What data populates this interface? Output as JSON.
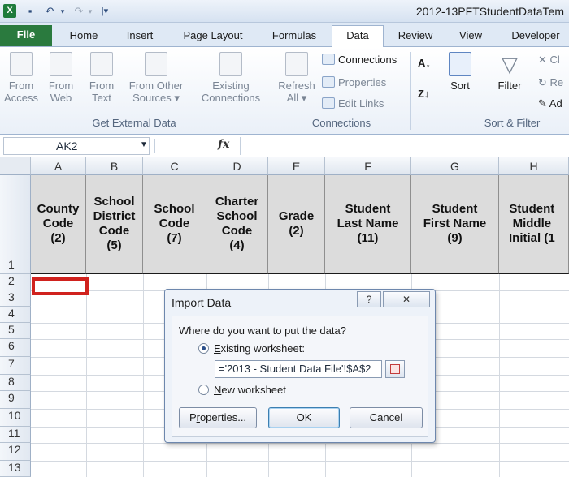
{
  "window": {
    "title": "2012-13PFTStudentDataTem"
  },
  "ribbon_tabs": [
    "File",
    "Home",
    "Insert",
    "Page Layout",
    "Formulas",
    "Data",
    "Review",
    "View",
    "Developer"
  ],
  "active_tab": "Data",
  "ribbon": {
    "get_external": {
      "buttons": [
        {
          "line1": "From",
          "line2": "Access"
        },
        {
          "line1": "From",
          "line2": "Web"
        },
        {
          "line1": "From",
          "line2": "Text"
        },
        {
          "line1": "From Other",
          "line2": "Sources ▾"
        },
        {
          "line1": "Existing",
          "line2": "Connections"
        }
      ],
      "label": "Get External Data"
    },
    "connections": {
      "refresh_line1": "Refresh",
      "refresh_line2": "All ▾",
      "items": [
        "Connections",
        "Properties",
        "Edit Links"
      ],
      "label": "Connections"
    },
    "sort_filter": {
      "sort": "Sort",
      "filter": "Filter",
      "partial": [
        "Cl",
        "Re",
        "Ad"
      ],
      "label": "Sort & Filter"
    }
  },
  "formula_bar": {
    "name_box": "AK2",
    "fx": "fx",
    "content": ""
  },
  "grid": {
    "columns": [
      "A",
      "B",
      "C",
      "D",
      "E",
      "F",
      "G",
      "H"
    ],
    "rows": [
      "1",
      "2",
      "3",
      "4",
      "5",
      "6",
      "7",
      "8",
      "9",
      "10",
      "11",
      "12",
      "13"
    ],
    "header_cells": [
      "County\nCode\n(2)",
      "School\nDistrict\nCode\n(5)",
      "School\nCode\n(7)",
      "Charter\nSchool\nCode\n(4)",
      "Grade\n(2)",
      "Student\nLast Name\n(11)",
      "Student\nFirst Name\n(9)",
      "Student\nMiddle\nInitial (1"
    ]
  },
  "dialog": {
    "title": "Import Data",
    "help": "?",
    "close": "✕",
    "question": "Where do you want to put the data?",
    "existing_label": "Existing worksheet:",
    "existing_hotkey": "E",
    "existing_rest": "xisting worksheet:",
    "reference": "='2013 - Student Data File'!$A$2",
    "new_hotkey": "N",
    "new_rest": "ew worksheet",
    "buttons": {
      "properties_pre": "P",
      "properties_hotkey": "r",
      "properties_rest": "operties...",
      "ok": "OK",
      "cancel": "Cancel"
    }
  }
}
